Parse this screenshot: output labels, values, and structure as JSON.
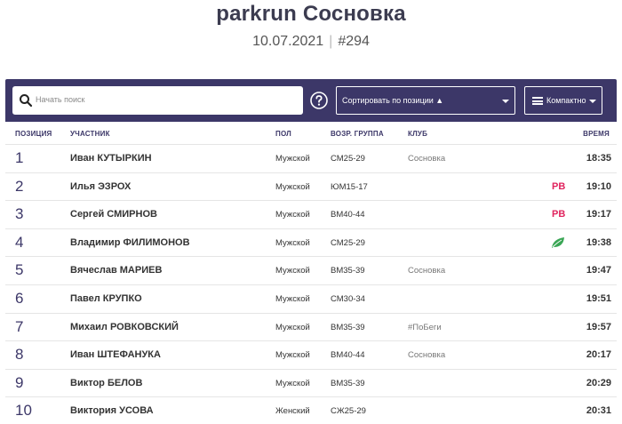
{
  "header": {
    "title": "parkrun Сосновка",
    "date": "10.07.2021",
    "separator": "|",
    "event_number": "#294"
  },
  "controls": {
    "search_placeholder": "Начать поиск",
    "search_icon": "search-icon",
    "help_icon": "help-circle-icon",
    "sort_label": "Сортировать по позиции ▲",
    "view_label": "Компактно"
  },
  "table": {
    "columns": {
      "position": "ПОЗИЦИЯ",
      "participant": "УЧАСТНИК",
      "gender": "ПОЛ",
      "age_group": "ВОЗР. ГРУППА",
      "club": "КЛУБ",
      "time": "ВРЕМЯ"
    },
    "rows": [
      {
        "position": "1",
        "name": "Иван КУТЫРКИН",
        "gender": "Мужской",
        "age_group": "СМ25-29",
        "club": "Сосновка",
        "badge": "",
        "time": "18:35"
      },
      {
        "position": "2",
        "name": "Илья ЭЗРОХ",
        "gender": "Мужской",
        "age_group": "ЮМ15-17",
        "club": "",
        "badge": "PB",
        "time": "19:10"
      },
      {
        "position": "3",
        "name": "Сергей СМИРНОВ",
        "gender": "Мужской",
        "age_group": "ВМ40-44",
        "club": "",
        "badge": "PB",
        "time": "19:17"
      },
      {
        "position": "4",
        "name": "Владимир ФИЛИМОНОВ",
        "gender": "Мужской",
        "age_group": "СМ25-29",
        "club": "",
        "badge": "leaf",
        "time": "19:38"
      },
      {
        "position": "5",
        "name": "Вячеслав МАРИЕВ",
        "gender": "Мужской",
        "age_group": "ВМ35-39",
        "club": "Сосновка",
        "badge": "",
        "time": "19:47"
      },
      {
        "position": "6",
        "name": "Павел КРУПКО",
        "gender": "Мужской",
        "age_group": "СМ30-34",
        "club": "",
        "badge": "",
        "time": "19:51"
      },
      {
        "position": "7",
        "name": "Михаил РОВКОВСКИЙ",
        "gender": "Мужской",
        "age_group": "ВМ35-39",
        "club": "#ПоБеги",
        "badge": "",
        "time": "19:57"
      },
      {
        "position": "8",
        "name": "Иван ШТЕФАНУКА",
        "gender": "Мужской",
        "age_group": "ВМ40-44",
        "club": "Сосновка",
        "badge": "",
        "time": "20:17"
      },
      {
        "position": "9",
        "name": "Виктор БЕЛОВ",
        "gender": "Мужской",
        "age_group": "ВМ35-39",
        "club": "",
        "badge": "",
        "time": "20:29"
      },
      {
        "position": "10",
        "name": "Виктория УСОВА",
        "gender": "Женский",
        "age_group": "СЖ25-29",
        "club": "",
        "badge": "",
        "time": "20:31"
      }
    ]
  },
  "colors": {
    "panel": "#3c3768",
    "pb": "#e0245e",
    "leaf": "#3aa655"
  }
}
